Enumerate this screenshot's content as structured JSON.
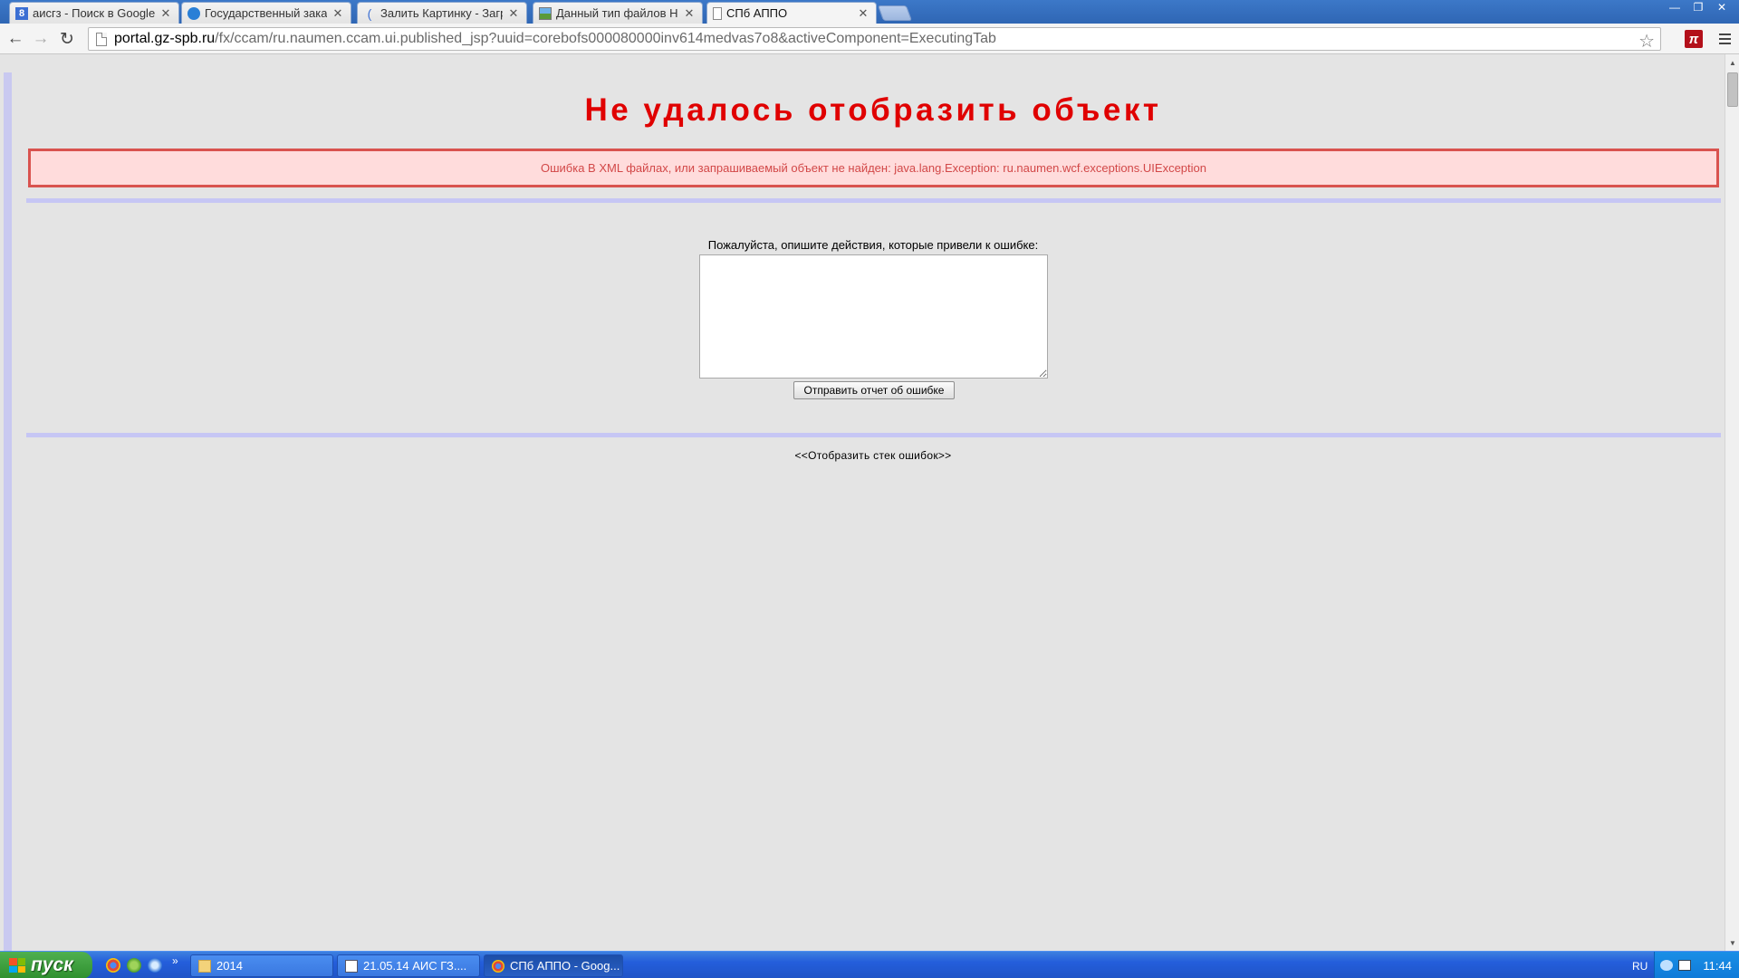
{
  "browser": {
    "tabs": [
      {
        "label": "аисгз - Поиск в Google",
        "icon": "google-icon",
        "active": false
      },
      {
        "label": "Государственный заказ",
        "icon": "globe-icon",
        "active": false
      },
      {
        "label": "Залить Картинку - Загр",
        "icon": "loading-icon",
        "active": false
      },
      {
        "label": "Данный тип файлов НЕ",
        "icon": "image-icon",
        "active": false
      },
      {
        "label": "СПб АППО",
        "icon": "page-icon",
        "active": true
      }
    ],
    "url_host": "portal.gz-spb.ru",
    "url_path": "/fx/ccam/ru.naumen.ccam.ui.published_jsp?uuid=corebofs000080000inv614medvas7o8&activeComponent=ExecutingTab"
  },
  "page": {
    "title": "Не удалось отобразить объект",
    "error_message": "Ошибка В XML файлах, или запрашиваемый объект не найден: java.lang.Exception: ru.naumen.wcf.exceptions.UIException",
    "prompt": "Пожалуйста, опишите действия, которые привели к ошибке:",
    "description_value": "",
    "submit_label": "Отправить отчет об ошибке",
    "stack_link": "<<Отобразить стек ошибок>>"
  },
  "taskbar": {
    "start_label": "пуск",
    "tasks": [
      {
        "label": "2014",
        "icon": "folder-icon",
        "active": false
      },
      {
        "label": "21.05.14 АИС ГЗ....",
        "icon": "document-icon",
        "active": false
      },
      {
        "label": "СПб АППО - Goog...",
        "icon": "chrome-icon",
        "active": true
      }
    ],
    "language": "RU",
    "clock": "11:44"
  },
  "colors": {
    "title_red": "#e00000",
    "error_bg": "#ffdcdc",
    "error_border": "#d9534f",
    "separator": "#c6c6f4",
    "taskbar_blue": "#245edb"
  }
}
